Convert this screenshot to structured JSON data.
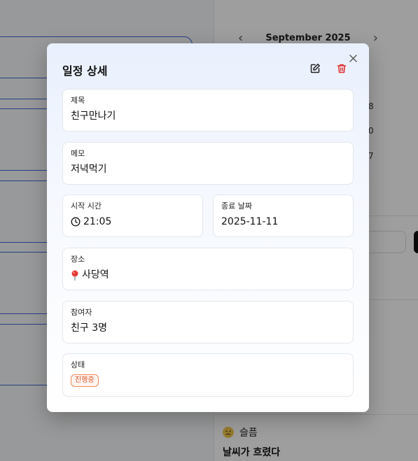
{
  "background": {
    "calendar_month": "September 2025",
    "calendar_prev": "‹",
    "calendar_next": "›",
    "calendar_numbers": [
      "8",
      "0",
      "7"
    ],
    "mood_label": "슬픔",
    "mood_icon": "sad-face-icon",
    "mood_note": "날씨가 흐렸다"
  },
  "modal": {
    "title": "일정 상세",
    "edit_icon": "edit-icon",
    "delete_icon": "trash-icon",
    "close_icon": "close-icon",
    "fields": {
      "title_label": "제목",
      "title_value": "친구만나기",
      "memo_label": "메모",
      "memo_value": "저녁먹기",
      "start_label": "시작 시간",
      "start_value": "21:05",
      "end_label": "종료 날짜",
      "end_value": "2025-11-11",
      "place_label": "장소",
      "place_value": "사당역",
      "participants_label": "참여자",
      "participants_value": "친구 3명",
      "status_label": "상태",
      "status_value": "진행중"
    }
  },
  "colors": {
    "accent_blue": "#3b66d8",
    "danger": "#e0302f",
    "status_orange": "#e2572b"
  }
}
